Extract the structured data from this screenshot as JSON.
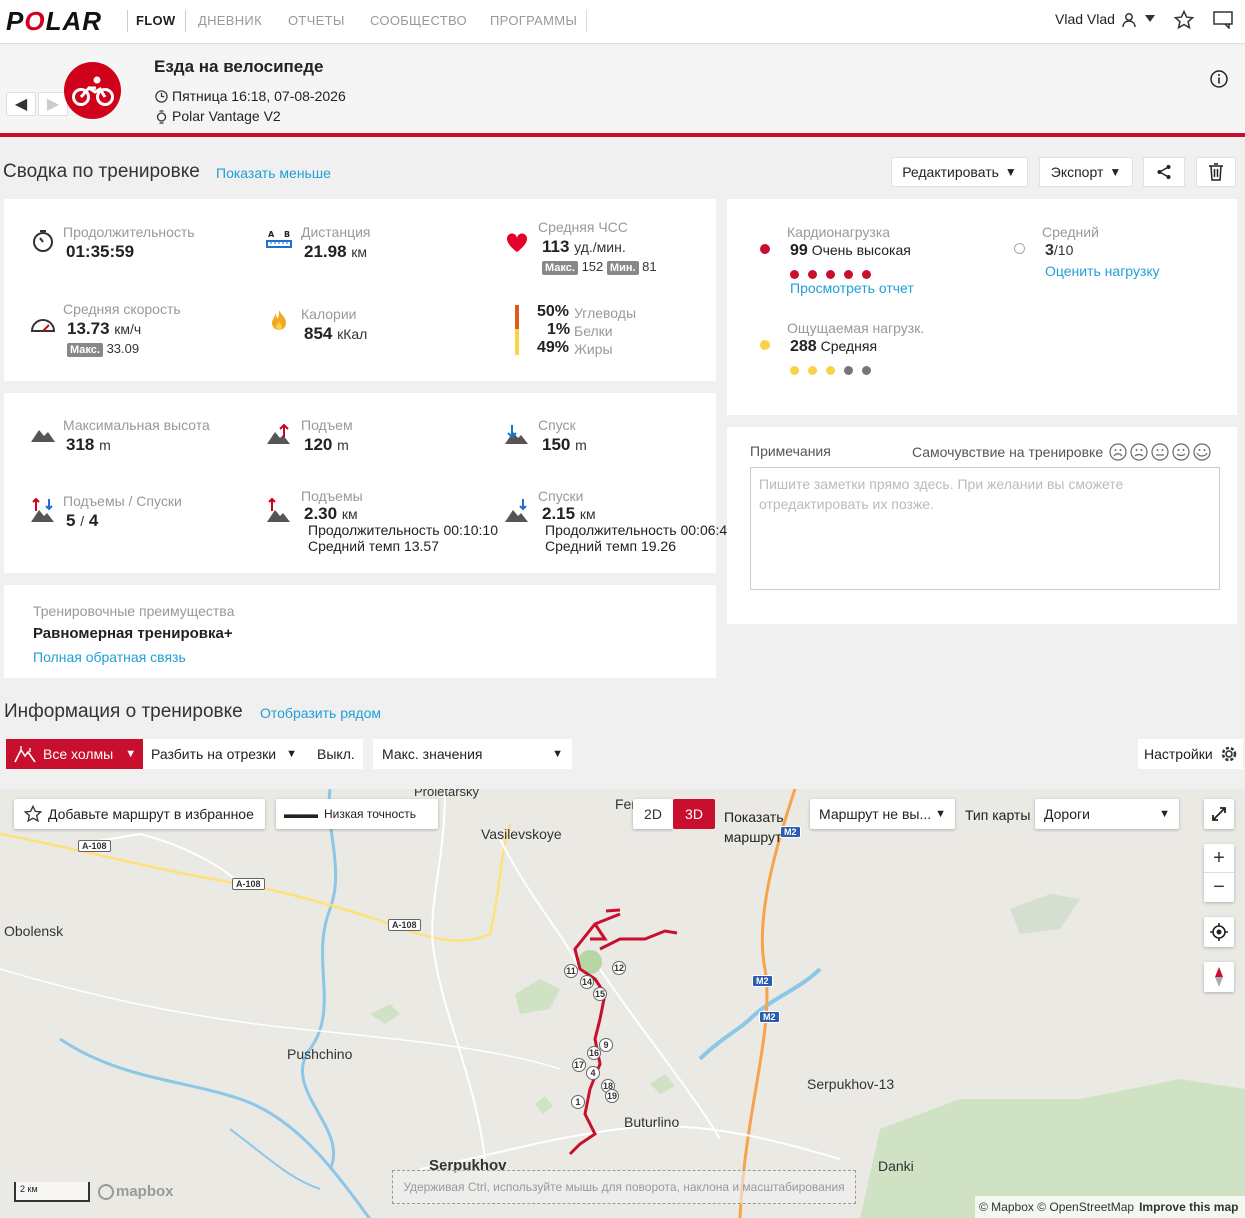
{
  "nav": {
    "logo": "POLAR",
    "flow": "FLOW",
    "items": [
      "ДНЕВНИК",
      "ОТЧЕТЫ",
      "СООБЩЕСТВО",
      "ПРОГРАММЫ"
    ],
    "user": "Vlad Vlad"
  },
  "header": {
    "title": "Езда на велосипеде",
    "datetime": "Пятница 16:18, 07-08-2026",
    "device": "Polar Vantage V2"
  },
  "summary": {
    "title": "Сводка по тренировке",
    "toggle": "Показать меньше",
    "edit": "Редактировать",
    "export": "Экспорт"
  },
  "stats": {
    "duration_label": "Продолжительность",
    "duration": "01:35:59",
    "distance_label": "Дистанция",
    "distance": "21.98",
    "distance_unit": "км",
    "hr_label": "Средняя ЧСС",
    "hr": "113",
    "hr_unit": "уд./мин.",
    "max": "Макс.",
    "hr_max": "152",
    "min": "Мин.",
    "hr_min": "81",
    "speed_label": "Средняя скорость",
    "speed": "13.73",
    "speed_unit": "км/ч",
    "speed_max": "33.09",
    "cal_label": "Калории",
    "cal": "854",
    "cal_unit": "кКал",
    "carbs_pct": "50%",
    "carbs": "Углеводы",
    "protein_pct": "1%",
    "protein": "Белки",
    "fat_pct": "49%",
    "fat": "Жиры"
  },
  "load": {
    "cardio_label": "Кардионагрузка",
    "cardio_val": "99",
    "cardio_text": "Очень высокая",
    "report": "Просмотреть отчет",
    "avg_label": "Средний",
    "avg_val": "3",
    "avg_den": "/10",
    "rate": "Оценить нагрузку",
    "perceived_label": "Ощущаемая нагрузк.",
    "perceived_val": "288",
    "perceived_text": "Средняя"
  },
  "alt": {
    "max_label": "Максимальная высота",
    "max": "318",
    "m": "m",
    "ascent_label": "Подъем",
    "ascent": "120",
    "descent_label": "Спуск",
    "descent": "150",
    "ud_label": "Подъемы / Спуски",
    "ups": "5",
    "slash": "/",
    "downs": "4",
    "climbs_label": "Подъемы",
    "climbs_dist": "2.30",
    "km": "км",
    "climbs_dur": "Продолжительность 00:10:10",
    "climbs_pace": "Средний темп 13.57",
    "desc_label": "Спуски",
    "desc_dist": "2.15",
    "desc_dur": "Продолжительность 00:06:4",
    "desc_pace": "Средний темп 19.26"
  },
  "benefit": {
    "label": "Тренировочные преимущества",
    "value": "Равномерная тренировка+",
    "link": "Полная обратная связь"
  },
  "notes": {
    "label": "Примечания",
    "feeling": "Самочувствие на тренировке",
    "placeholder": "Пишите заметки прямо здесь. При желании вы сможете отредактировать их позже."
  },
  "info": {
    "title": "Информация о тренировке",
    "link": "Отобразить рядом",
    "hills": "Все холмы",
    "split": "Разбить на отрезки",
    "off": "Выкл.",
    "maxvals": "Макс. значения",
    "settings": "Настройки"
  },
  "map": {
    "fav": "Добавьте маршрут в избранное",
    "precision": "Низкая точность",
    "d2": "2D",
    "d3": "3D",
    "show_route": "Показать маршрут",
    "route_sel": "Маршрут не вы...",
    "type_label": "Тип карты",
    "type_val": "Дороги",
    "places": {
      "proletarsky": "Proletarsky",
      "vasilevskoye": "Vasilevskoye",
      "obolensk": "Obolensk",
      "pushchino": "Pushchino",
      "serpukhov13": "Serpukhov-13",
      "buturlino": "Buturlino",
      "serpukhov": "Serpukhov",
      "danki": "Danki",
      "fer": "Fer"
    },
    "roads": {
      "a108": "A-108",
      "m2": "M2"
    },
    "scale": "2 км",
    "mapbox": "mapbox",
    "hint": "Удерживая Ctrl, используйте мышь для поворота, наклона и масштабирования",
    "credit": "© Mapbox © OpenStreetMap",
    "improve": "Improve this map",
    "markers": [
      "11",
      "12",
      "14",
      "15",
      "9",
      "16",
      "17",
      "4",
      "18",
      "19",
      "1"
    ]
  }
}
